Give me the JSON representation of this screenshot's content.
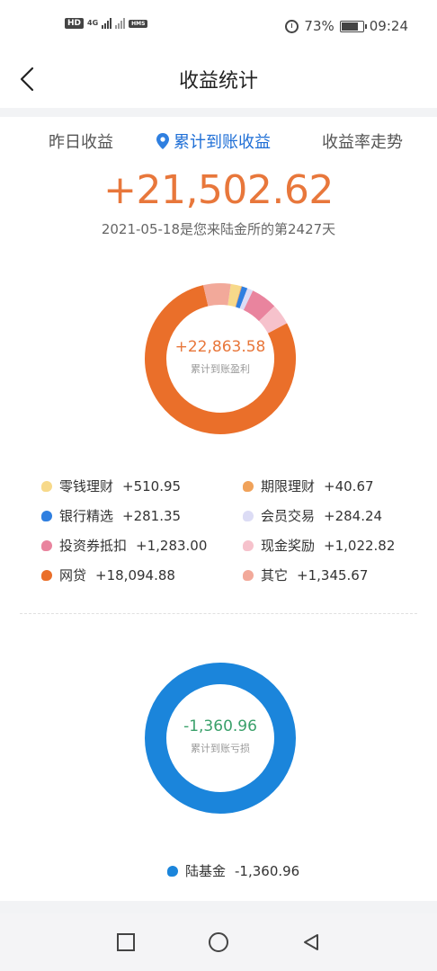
{
  "status_bar": {
    "left_badge": "HD",
    "network_label": "4G",
    "hms_badge": "HMS",
    "battery_percent": "73%",
    "time": "09:24"
  },
  "header": {
    "title": "收益统计"
  },
  "tabs": [
    {
      "label": "昨日收益"
    },
    {
      "label": "累计到账收益",
      "active": true
    },
    {
      "label": "收益率走势"
    }
  ],
  "summary": {
    "total": "+21,502.62",
    "subline": "2021-05-18是您来陆金所的第2427天"
  },
  "profit_chart": {
    "center_value": "+22,863.58",
    "center_label": "累计到账盈利",
    "center_color": "#e8773b",
    "items": [
      {
        "label": "零钱理财",
        "value": "+510.95",
        "amount": 510.95,
        "color": "#f7d98a"
      },
      {
        "label": "期限理财",
        "value": "+40.67",
        "amount": 40.67,
        "color": "#f0a25a"
      },
      {
        "label": "银行精选",
        "value": "+281.35",
        "amount": 281.35,
        "color": "#2f7fe0"
      },
      {
        "label": "会员交易",
        "value": "+284.24",
        "amount": 284.24,
        "color": "#dcdcf5"
      },
      {
        "label": "投资券抵扣",
        "value": "+1,283.00",
        "amount": 1283.0,
        "color": "#e9849e"
      },
      {
        "label": "现金奖励",
        "value": "+1,022.82",
        "amount": 1022.82,
        "color": "#f6c2cc"
      },
      {
        "label": "网贷",
        "value": "+18,094.88",
        "amount": 18094.88,
        "color": "#ea6f2a"
      },
      {
        "label": "其它",
        "value": "+1,345.67",
        "amount": 1345.67,
        "color": "#f2a99a"
      }
    ]
  },
  "loss_chart": {
    "center_value": "-1,360.96",
    "center_label": "累计到账亏损",
    "center_color": "#3aa06a",
    "ring_color": "#1b85db",
    "items": [
      {
        "label": "陆基金",
        "value": "-1,360.96",
        "color": "#1b85db"
      }
    ]
  }
}
